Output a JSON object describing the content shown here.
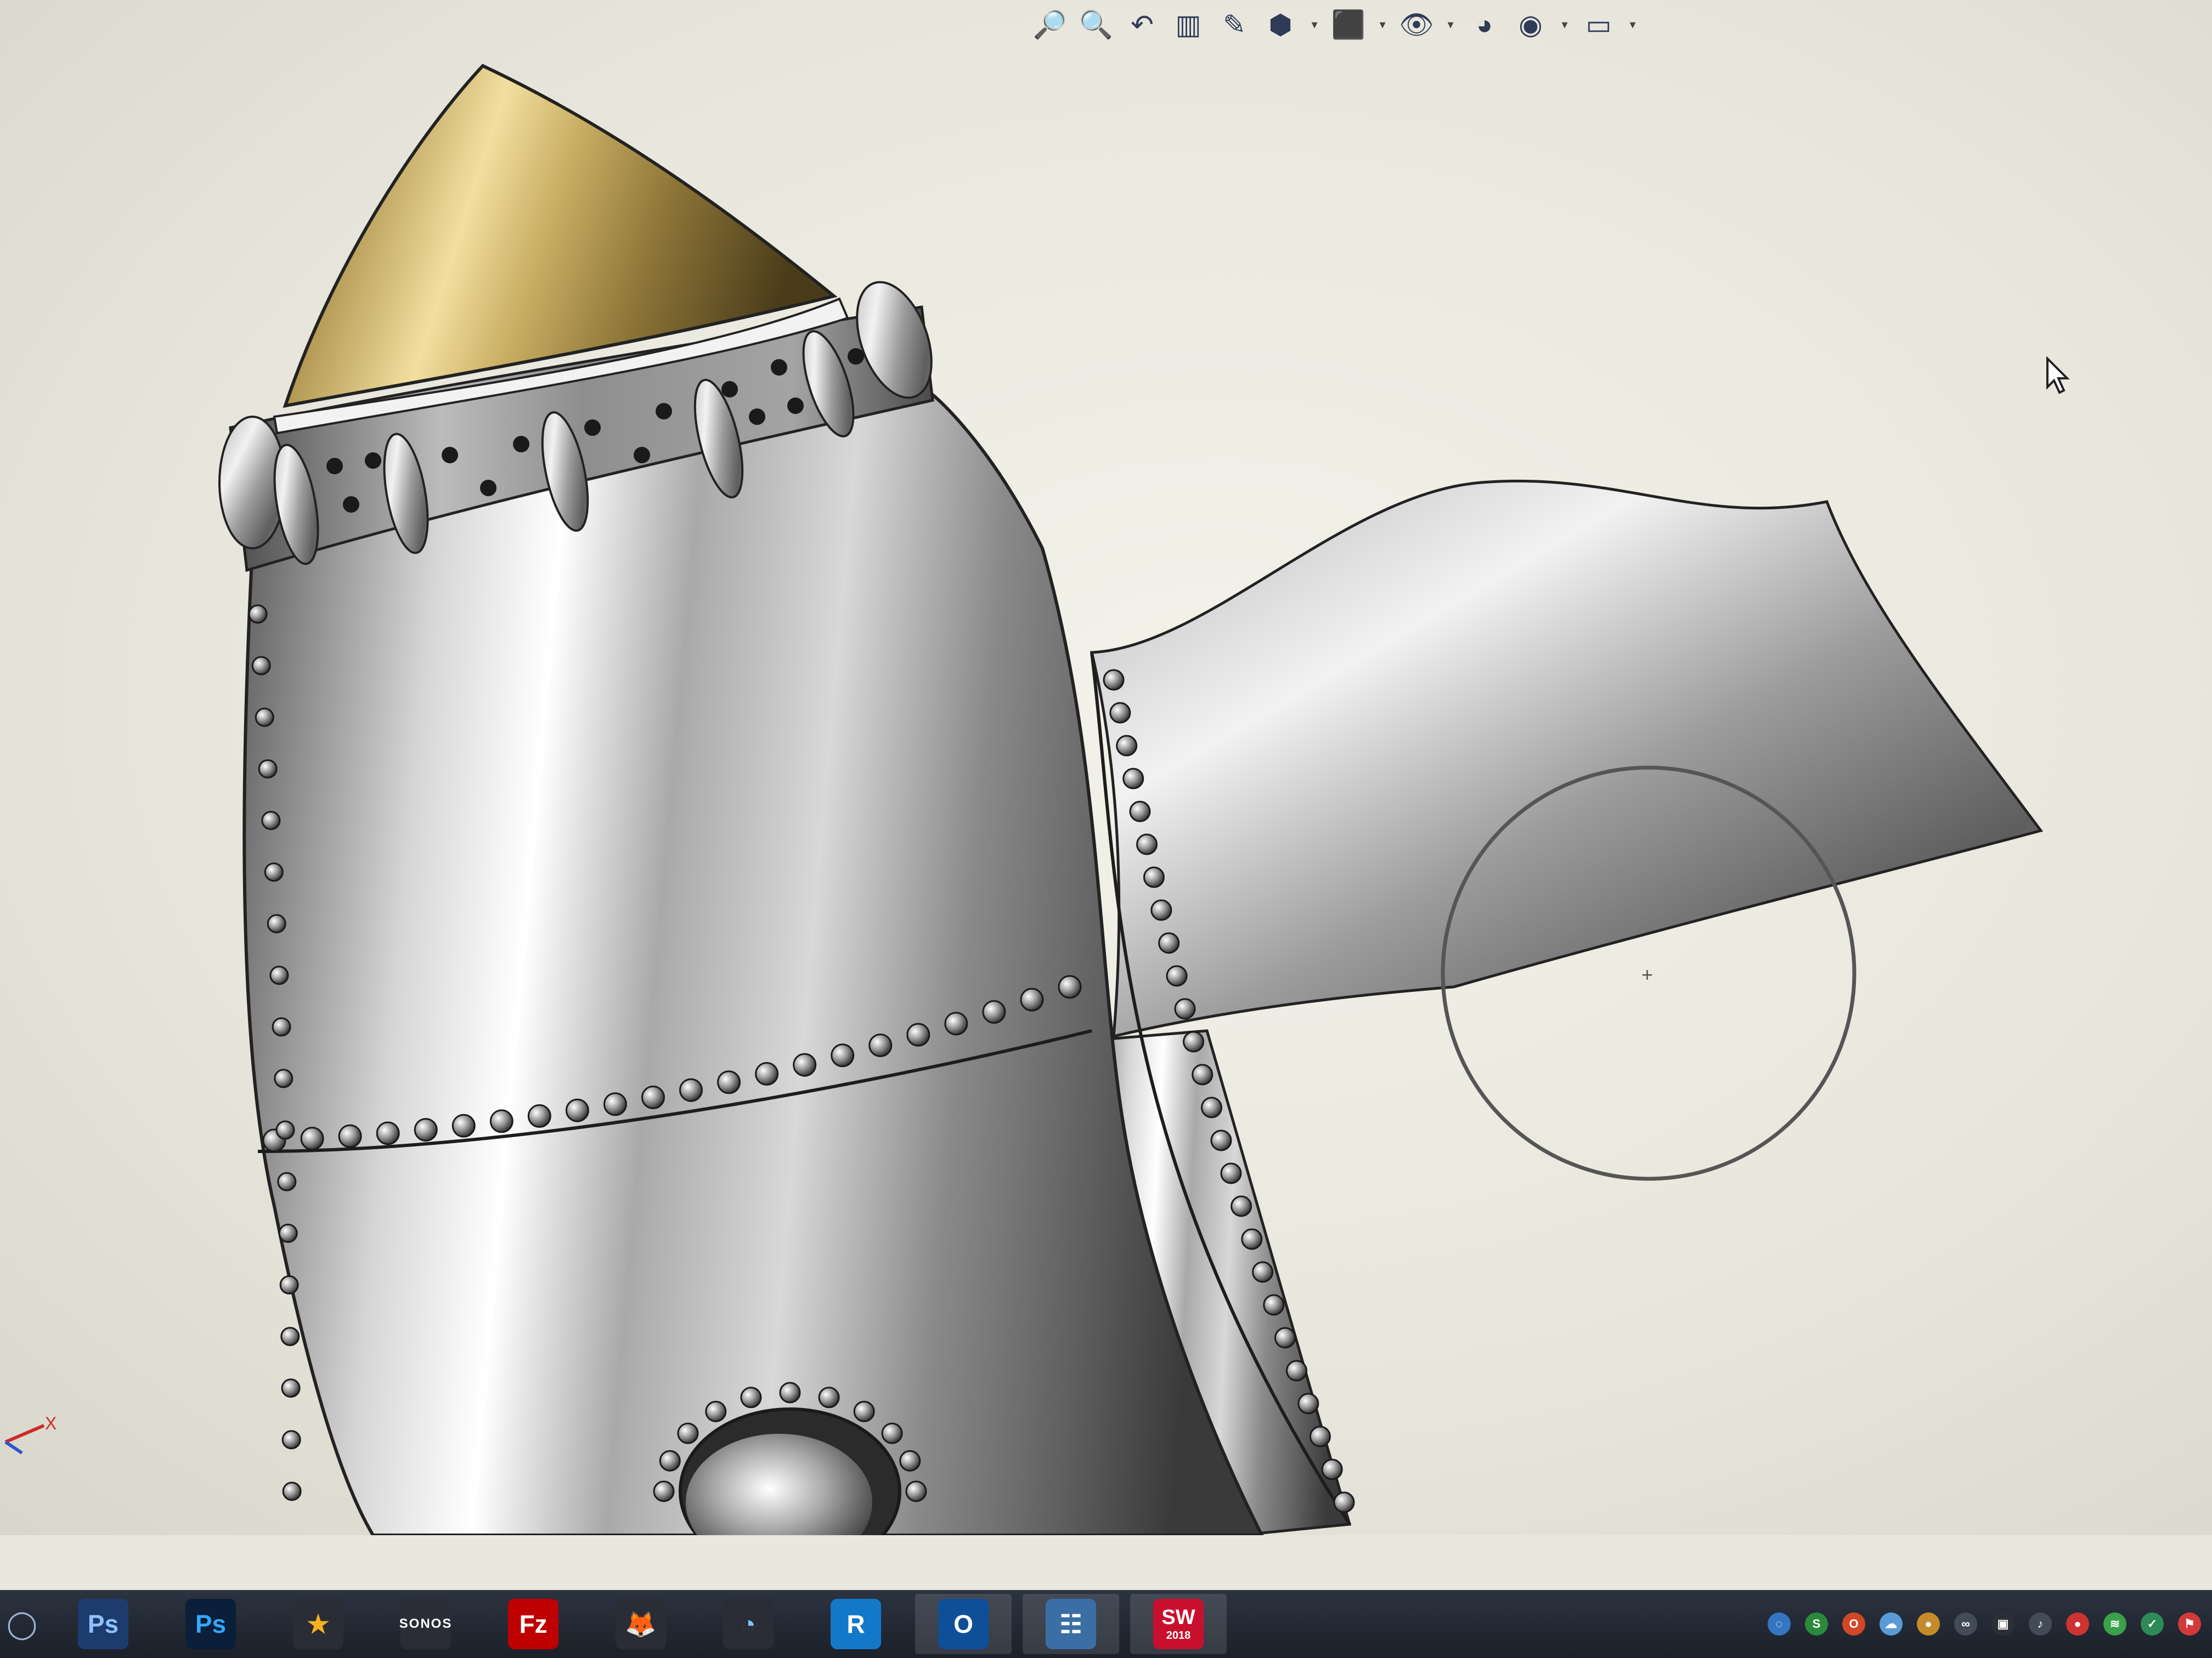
{
  "window": {
    "application": "SOLIDWORKS 2018",
    "background_color": "#eceae2"
  },
  "heads_up_toolbar": {
    "items": [
      {
        "icon": "zoom-to-fit-icon",
        "glyph": "🔎"
      },
      {
        "icon": "zoom-to-area-icon",
        "glyph": "🔍"
      },
      {
        "icon": "previous-view-icon",
        "glyph": "↶"
      },
      {
        "icon": "section-view-icon",
        "glyph": "▥"
      },
      {
        "icon": "dynamic-annotation-icon",
        "glyph": "✎"
      },
      {
        "icon": "view-orientation-icon",
        "glyph": "⬢",
        "dropdown": true
      },
      {
        "icon": "display-style-icon",
        "glyph": "⬛",
        "dropdown": true
      },
      {
        "icon": "hide-show-items-icon",
        "glyph": "👁",
        "dropdown": true
      },
      {
        "icon": "edit-appearance-icon",
        "glyph": "◕",
        "dropdown": false
      },
      {
        "icon": "apply-scene-icon",
        "glyph": "◉",
        "dropdown": true
      },
      {
        "icon": "view-settings-icon",
        "glyph": "▭",
        "dropdown": true
      }
    ]
  },
  "triad": {
    "x_label": "X",
    "x_color": "#cc2a2a"
  },
  "taskbar": {
    "apps": [
      {
        "name": "photoshop-classic",
        "label": "Ps",
        "bg": "#1d3c6e",
        "fg": "#8fc2ff",
        "active": false
      },
      {
        "name": "photoshop",
        "label": "Ps",
        "bg": "#0b1e3a",
        "fg": "#31a8ff",
        "active": false
      },
      {
        "name": "app-yellow",
        "label": "★",
        "bg": "#2a2d35",
        "fg": "#f6b11f",
        "active": false
      },
      {
        "name": "sonos",
        "label": "SONOS",
        "bg": "#2a2d35",
        "fg": "#ffffff",
        "active": false
      },
      {
        "name": "filezilla",
        "label": "Fz",
        "bg": "#bf0000",
        "fg": "#ffffff",
        "active": false
      },
      {
        "name": "firefox",
        "label": "🦊",
        "bg": "#2a2d35",
        "fg": "#ff8a00",
        "active": false
      },
      {
        "name": "chrome-remote",
        "label": "◔",
        "bg": "#2a2d35",
        "fg": "#7cc6ff",
        "active": false
      },
      {
        "name": "r-app",
        "label": "R",
        "bg": "#1478c8",
        "fg": "#ffffff",
        "active": false
      },
      {
        "name": "outlook",
        "label": "O",
        "bg": "#0f4f9a",
        "fg": "#ffffff",
        "active": true
      },
      {
        "name": "control-panel",
        "label": "☷",
        "bg": "#3a6ea5",
        "fg": "#ffffff",
        "active": true
      },
      {
        "name": "solidworks",
        "label": "SW",
        "sublabel": "2018",
        "bg": "#c8102e",
        "fg": "#ffffff",
        "active": true
      }
    ]
  },
  "tray": {
    "icons": [
      {
        "name": "network-tray-icon",
        "label": "◌",
        "bg": "#3576c4"
      },
      {
        "name": "antivirus-tray-icon",
        "label": "S",
        "bg": "#2a8a3a"
      },
      {
        "name": "office-tray-icon",
        "label": "O",
        "bg": "#d24726"
      },
      {
        "name": "onedrive-tray-icon",
        "label": "☁",
        "bg": "#5b9bd5"
      },
      {
        "name": "app-tray-icon",
        "label": "●",
        "bg": "#c58b2a"
      },
      {
        "name": "cloud-tray-icon",
        "label": "∞",
        "bg": "#444b58"
      },
      {
        "name": "monitor-tray-icon",
        "label": "▣",
        "bg": "#2b2f38"
      },
      {
        "name": "volume-tray-icon",
        "label": "♪",
        "bg": "#444b58"
      },
      {
        "name": "power-tray-icon",
        "label": "●",
        "bg": "#cc3333"
      },
      {
        "name": "sync-tray-icon",
        "label": "≋",
        "bg": "#3aa04a"
      },
      {
        "name": "check-tray-icon",
        "label": "✓",
        "bg": "#2e8b57"
      },
      {
        "name": "flag-tray-icon",
        "label": "⚑",
        "bg": "#d23a3a"
      }
    ]
  }
}
